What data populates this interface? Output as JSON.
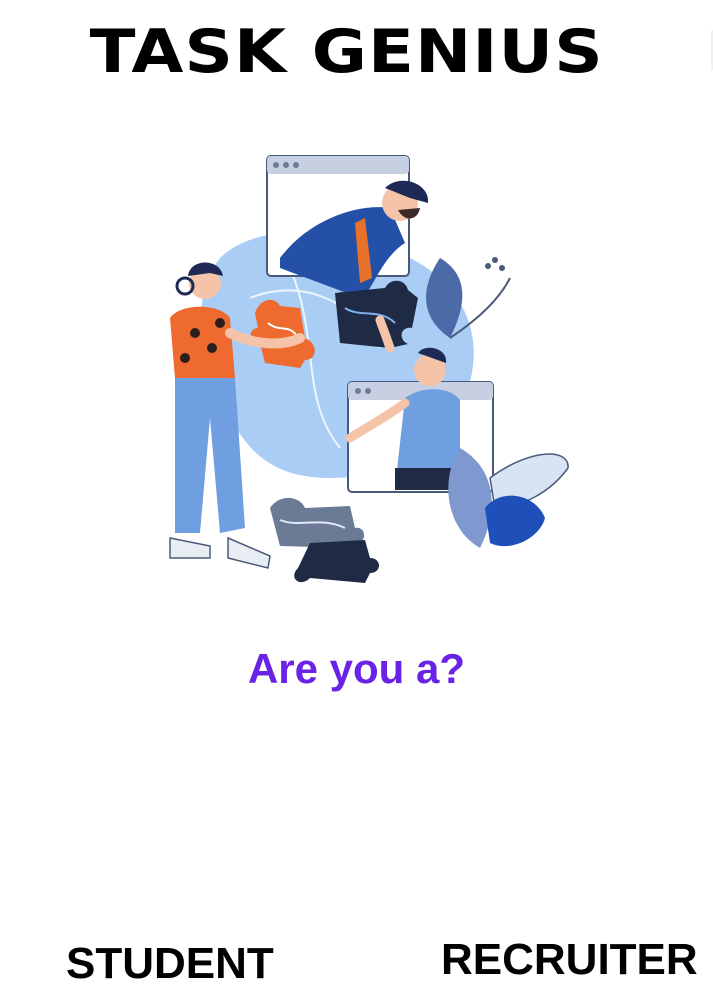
{
  "app": {
    "title": "TASK GENIUS"
  },
  "illustration": {
    "name": "team-collaboration-puzzle"
  },
  "prompt": {
    "question": "Are you a?"
  },
  "roles": {
    "student_label": "STUDENT",
    "recruiter_label": "RECRUITER"
  },
  "colors": {
    "accent": "#6a22e6",
    "text": "#000000",
    "background": "#ffffff"
  }
}
